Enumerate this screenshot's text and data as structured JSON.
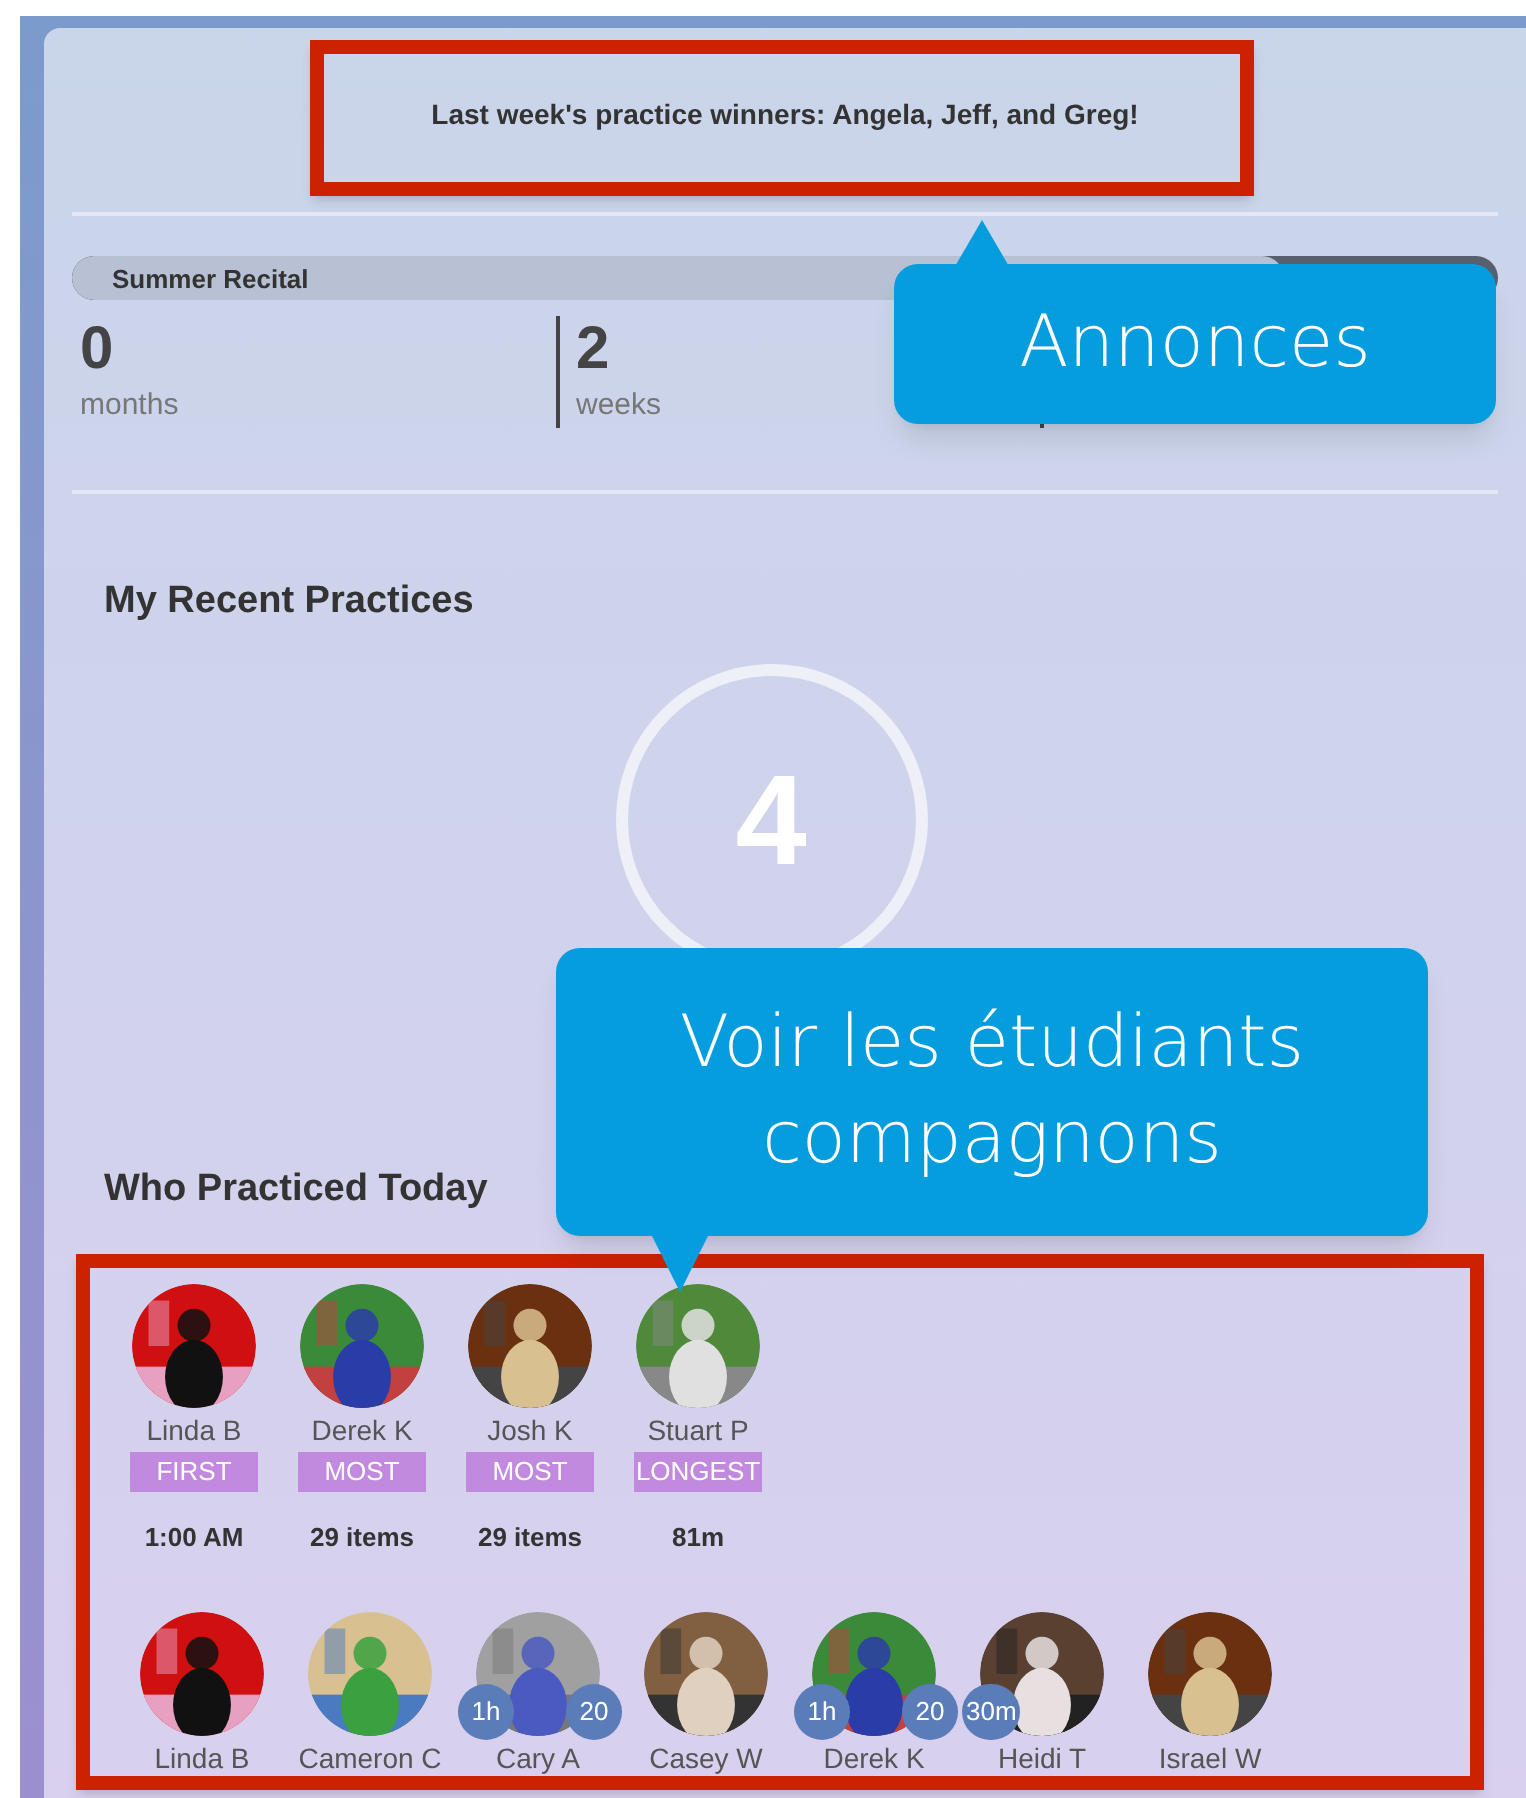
{
  "announcement": "Last week's practice winners: Angela, Jeff, and Greg!",
  "countdown": {
    "title": "Summer Recital",
    "level": 0.85,
    "units": [
      {
        "value": "0",
        "label": "months"
      },
      {
        "value": "2",
        "label": "weeks"
      }
    ]
  },
  "recent": {
    "title": "My Recent Practices",
    "count": "4"
  },
  "today": {
    "title": "Who Practiced Today",
    "winners": [
      {
        "name": "Linda B",
        "award": "FIRST",
        "stat": "1:00 AM"
      },
      {
        "name": "Derek K",
        "award": "MOST",
        "stat": "29 items"
      },
      {
        "name": "Josh K",
        "award": "MOST",
        "stat": "29 items"
      },
      {
        "name": "Stuart P",
        "award": "LONGEST",
        "stat": "81m"
      }
    ],
    "students": [
      {
        "name": "Linda B"
      },
      {
        "name": "Cameron C"
      },
      {
        "name": "Cary A",
        "badges": [
          {
            "kind": "time",
            "text": "1h"
          },
          {
            "kind": "count",
            "text": "20"
          }
        ]
      },
      {
        "name": "Casey W"
      },
      {
        "name": "Derek K",
        "badges": [
          {
            "kind": "time",
            "text": "1h"
          },
          {
            "kind": "count",
            "text": "20"
          }
        ]
      },
      {
        "name": "Heidi T",
        "badges": [
          {
            "kind": "time",
            "text": "30m"
          }
        ]
      },
      {
        "name": "Israel W"
      }
    ]
  },
  "callouts": [
    {
      "text": "Annonces"
    },
    {
      "text": "Voir les étudiants compagnons"
    }
  ]
}
